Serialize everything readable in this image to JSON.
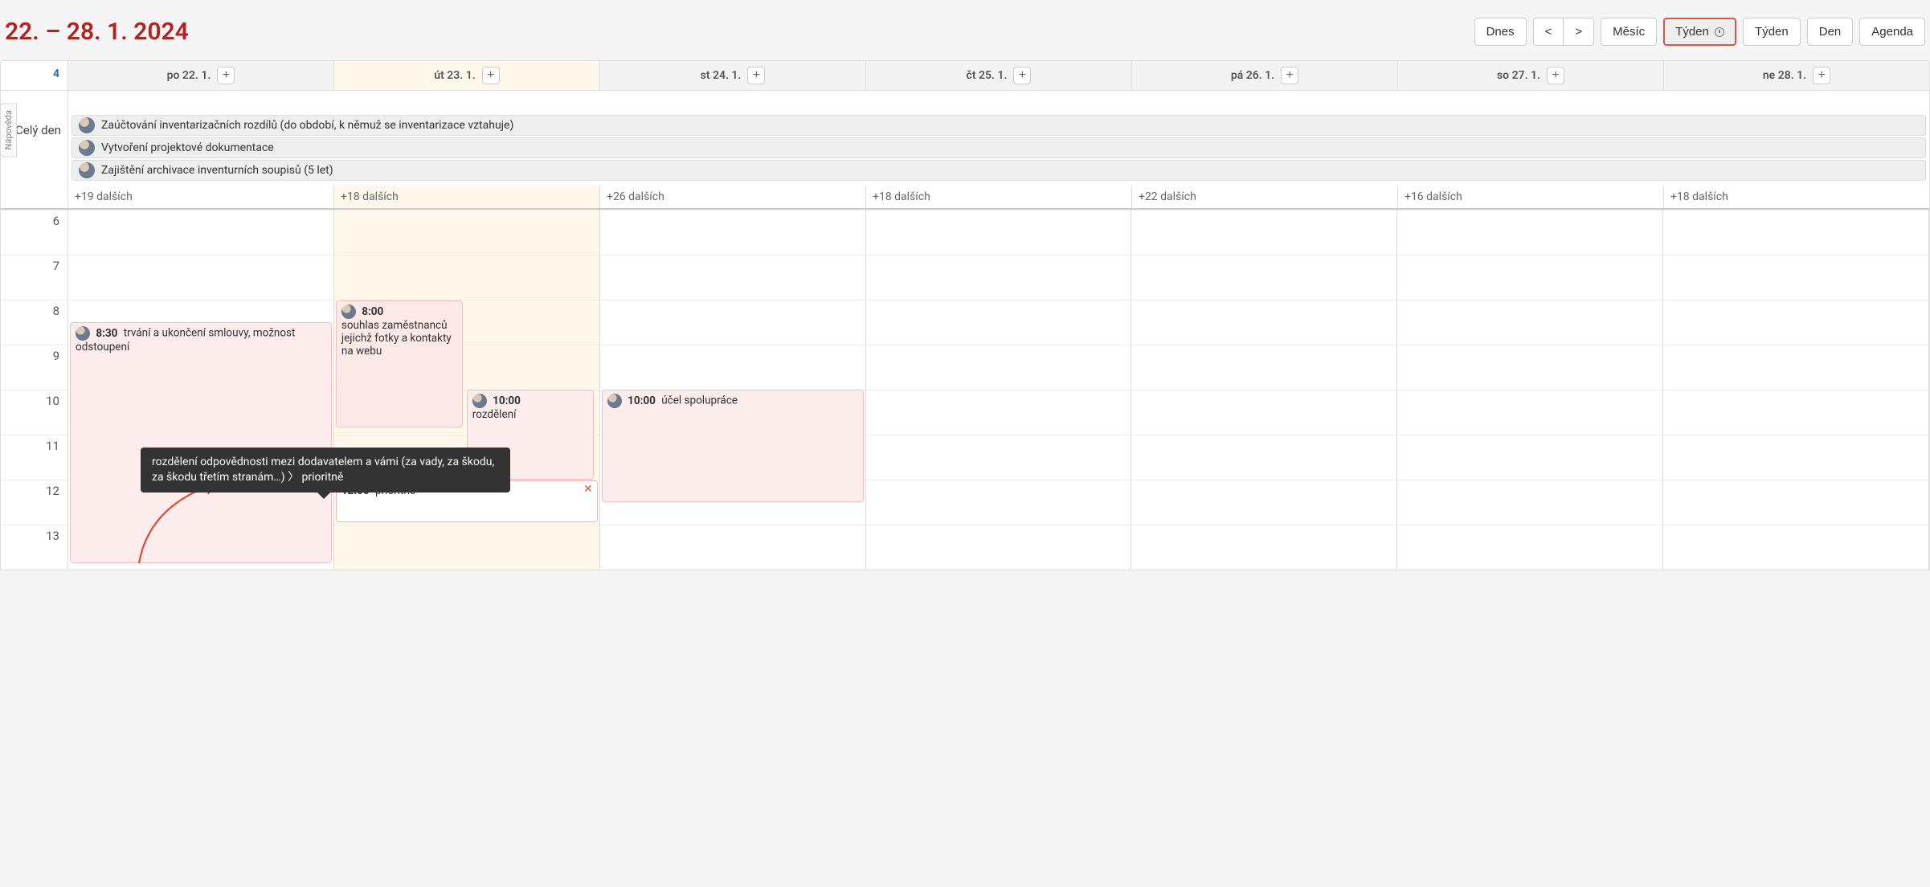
{
  "title": "22. – 28. 1. 2024",
  "weekNumber": "4",
  "helpTab": "Nápověda",
  "toolbar": {
    "today": "Dnes",
    "prev": "<",
    "next": ">",
    "month": "Měsíc",
    "weekClock": "Týden",
    "week": "Týden",
    "day": "Den",
    "agenda": "Agenda"
  },
  "days": [
    {
      "label": "po 22. 1."
    },
    {
      "label": "út 23. 1."
    },
    {
      "label": "st 24. 1."
    },
    {
      "label": "čt 25. 1."
    },
    {
      "label": "pá 26. 1."
    },
    {
      "label": "so 27. 1."
    },
    {
      "label": "ne 28. 1."
    }
  ],
  "allday": {
    "label": "Celý den",
    "events": [
      "Zaúčtování inventarizačních rozdílů (do období, k němuž se inventarizace vztahuje)",
      "Vytvoření projektové dokumentace",
      "Zajištění archivace inventurních soupisů (5 let)"
    ],
    "more": [
      "+19 dalších",
      "+18 dalších",
      "+26 dalších",
      "+18 dalších",
      "+22 dalších",
      "+16 dalších",
      "+18 dalších"
    ]
  },
  "hours": [
    "6",
    "7",
    "8",
    "9",
    "10",
    "11",
    "12",
    "13"
  ],
  "events": {
    "mon830": {
      "time": "8:30",
      "text": "trvání a ukončení smlouvy, možnost odstoupení"
    },
    "tue800": {
      "time": "8:00",
      "text": "souhlas zaměstnanců jejichž fotky a kontakty na webu"
    },
    "tue1000": {
      "time": "10:00",
      "text": "rozdělení"
    },
    "tue1200": {
      "time": "12:00",
      "text": "prioritně"
    },
    "wed1000": {
      "time": "10:00",
      "text": "účel spolupráce"
    }
  },
  "tooltip": "rozdělení odpovědnosti mezi dodavatelem a vámi (za vady, za škodu, za škodu třetím stranám…)  〉 prioritně"
}
